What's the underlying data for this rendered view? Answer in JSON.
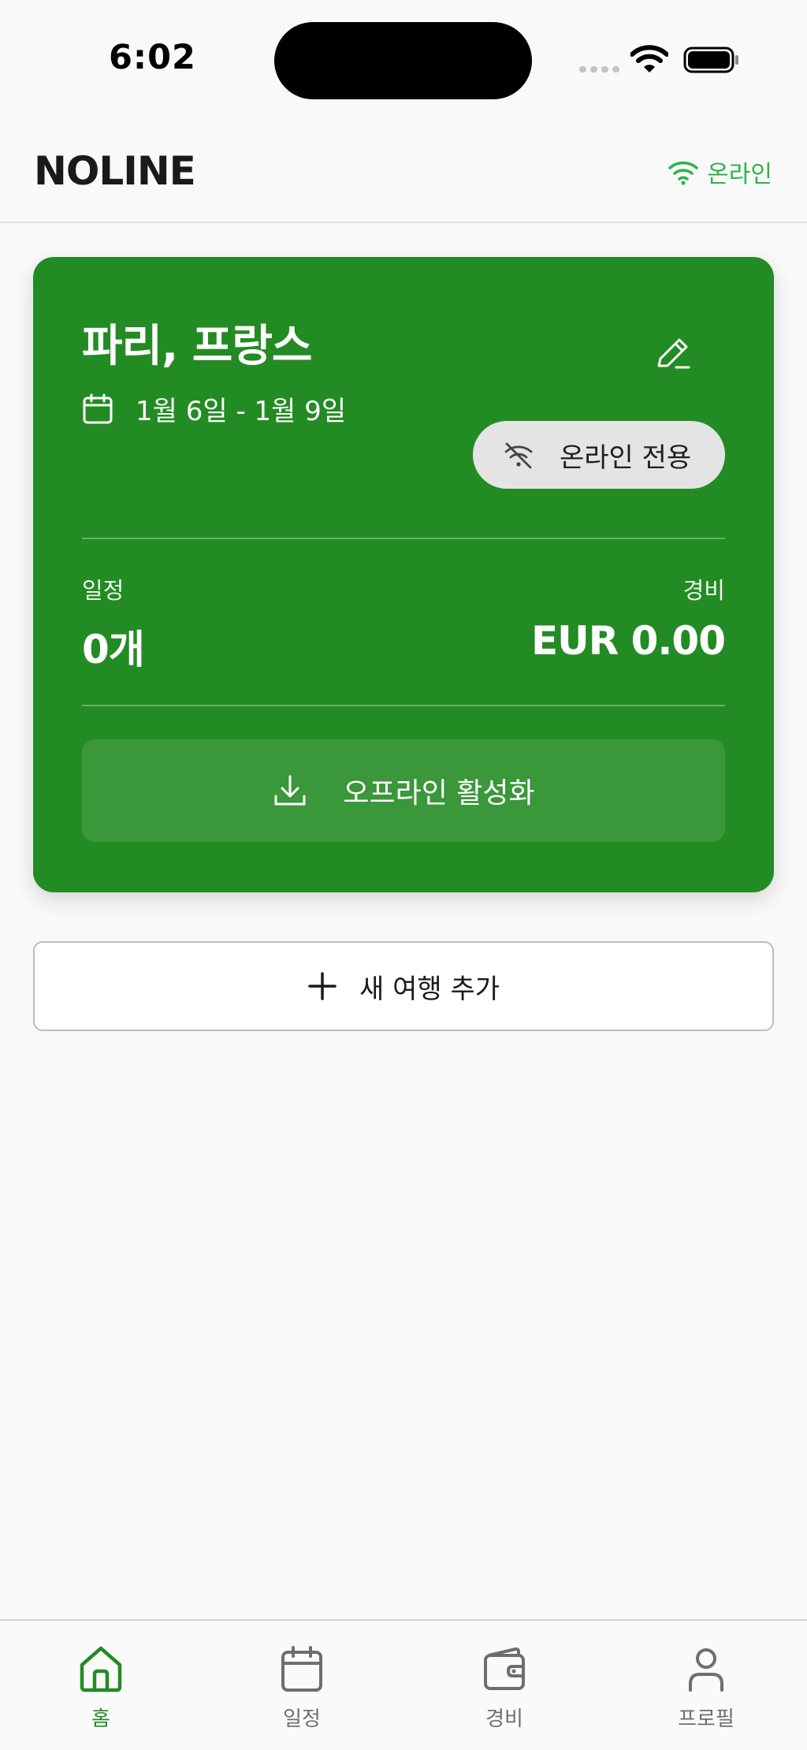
{
  "status_bar": {
    "time": "6:02"
  },
  "header": {
    "app_name": "NOLINE",
    "connection_label": "온라인"
  },
  "trip": {
    "title": "파리, 프랑스",
    "date_range": "1월 6일 - 1월 9일",
    "mode_label": "온라인 전용",
    "schedule_label": "일정",
    "schedule_value": "0개",
    "expense_label": "경비",
    "expense_value": "EUR 0.00",
    "offline_button": "오프라인 활성화"
  },
  "add_trip_label": "새 여행 추가",
  "tabs": [
    {
      "label": "홈",
      "icon": "home-icon",
      "active": true
    },
    {
      "label": "일정",
      "icon": "calendar-icon",
      "active": false
    },
    {
      "label": "경비",
      "icon": "wallet-icon",
      "active": false
    },
    {
      "label": "프로필",
      "icon": "person-icon",
      "active": false
    }
  ],
  "colors": {
    "brand_green": "#238b23",
    "online_green": "#2db34a",
    "background": "#f9f9f9",
    "inactive_tab": "#6e6e6e"
  }
}
